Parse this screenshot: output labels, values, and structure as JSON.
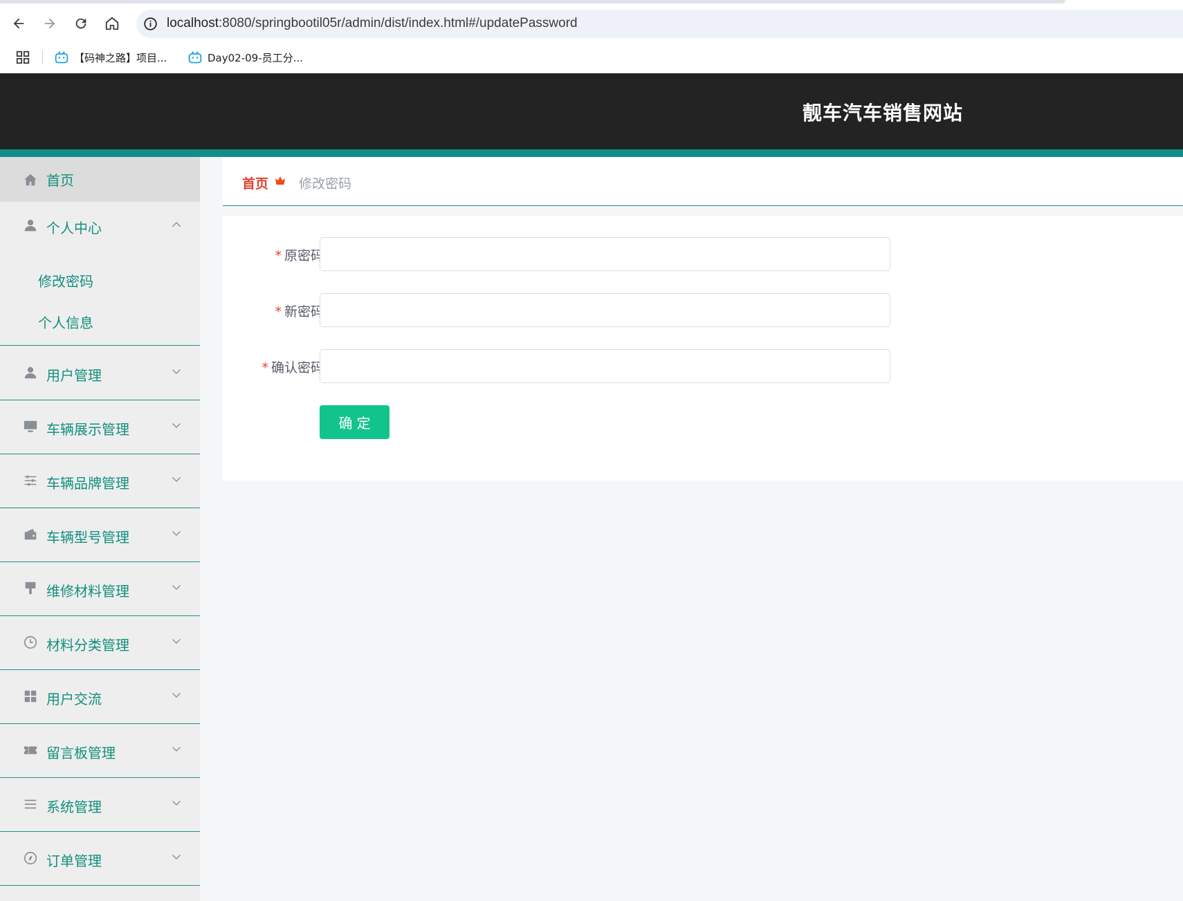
{
  "browser": {
    "url_host": "localhost",
    "url_rest": ":8080/springbootil05r/admin/dist/index.html#/updatePassword",
    "bookmarks": [
      {
        "label": "【码神之路】项目..."
      },
      {
        "label": "Day02-09-员工分..."
      }
    ]
  },
  "header": {
    "site_title": "靓车汽车销售网站"
  },
  "sidebar": {
    "home": {
      "label": "首页",
      "icon": "home-icon"
    },
    "personal": {
      "label": "个人中心",
      "icon": "user-icon",
      "expanded": true,
      "children": [
        {
          "label": "修改密码"
        },
        {
          "label": "个人信息"
        }
      ]
    },
    "items": [
      {
        "label": "用户管理",
        "icon": "user-icon"
      },
      {
        "label": "车辆展示管理",
        "icon": "monitor-icon"
      },
      {
        "label": "车辆品牌管理",
        "icon": "sliders-icon"
      },
      {
        "label": "车辆型号管理",
        "icon": "wallet-icon"
      },
      {
        "label": "维修材料管理",
        "icon": "brush-icon"
      },
      {
        "label": "材料分类管理",
        "icon": "clock-icon"
      },
      {
        "label": "用户交流",
        "icon": "grid-icon"
      },
      {
        "label": "留言板管理",
        "icon": "ticket-icon"
      },
      {
        "label": "系统管理",
        "icon": "list-icon"
      },
      {
        "label": "订单管理",
        "icon": "compass-icon"
      }
    ]
  },
  "breadcrumb": {
    "home": "首页",
    "current": "修改密码"
  },
  "form": {
    "required_mark": "*",
    "fields": [
      {
        "label": "原密码",
        "value": ""
      },
      {
        "label": "新密码",
        "value": ""
      },
      {
        "label": "确认密码",
        "value": ""
      }
    ],
    "submit_label": "确定"
  },
  "colors": {
    "accent": "#12907f",
    "header_bg": "#232323",
    "teal_bar": "#0f8f88",
    "required": "#e0412b",
    "button": "#12c48c"
  }
}
